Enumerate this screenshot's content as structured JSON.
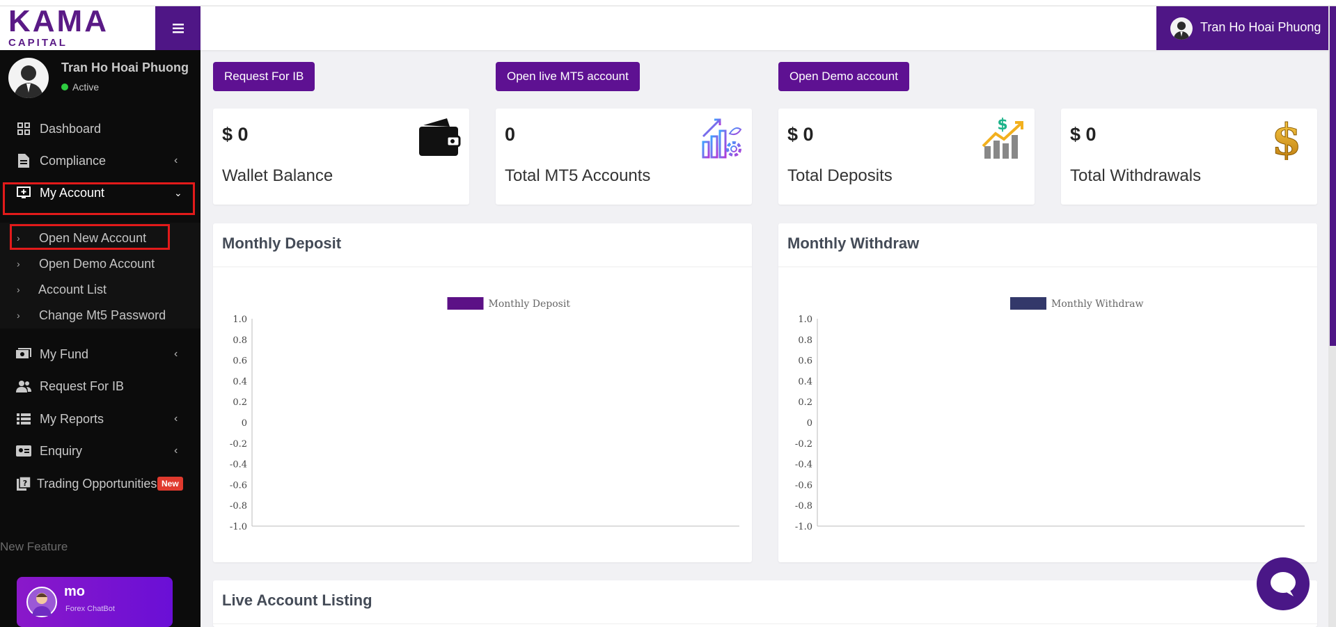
{
  "brand": {
    "logo_text": "KAMA",
    "logo_subtext": "CAPITAL"
  },
  "sidebar": {
    "user": {
      "name": "Tran Ho Hoai Phuong",
      "status": "Active"
    },
    "items": [
      {
        "label": "Dashboard",
        "icon": "grid-icon",
        "has_chevron": false
      },
      {
        "label": "Compliance",
        "icon": "document-icon",
        "has_chevron": true
      },
      {
        "label": "My Account",
        "icon": "monitor-plus-icon",
        "has_chevron": true,
        "expanded": true
      },
      {
        "label": "My Fund",
        "icon": "money-icon",
        "has_chevron": true
      },
      {
        "label": "Request For IB",
        "icon": "users-icon",
        "has_chevron": false
      },
      {
        "label": "My Reports",
        "icon": "list-icon",
        "has_chevron": true
      },
      {
        "label": "Enquiry",
        "icon": "id-card-icon",
        "has_chevron": true
      },
      {
        "label": "Trading Opportunities",
        "icon": "clipboard-question-icon",
        "has_chevron": false,
        "badge": "New"
      }
    ],
    "submenu": [
      {
        "label": "Open New Account"
      },
      {
        "label": "Open Demo Account"
      },
      {
        "label": "Account List"
      },
      {
        "label": "Change Mt5 Password"
      }
    ],
    "new_feature_label": "New Feature",
    "chatbot": {
      "title": "mo",
      "subtitle": "Forex ChatBot"
    }
  },
  "header": {
    "user_name": "Tran Ho Hoai Phuong"
  },
  "actions": {
    "request_ib": "Request For IB",
    "open_live": "Open live MT5 account",
    "open_demo": "Open Demo account"
  },
  "stats": [
    {
      "value": "$ 0",
      "label": "Wallet Balance",
      "icon": "wallet-icon"
    },
    {
      "value": "0",
      "label": "Total MT5 Accounts",
      "icon": "growth-chart-gear-icon"
    },
    {
      "value": "$ 0",
      "label": "Total Deposits",
      "icon": "dollar-bar-chart-icon"
    },
    {
      "value": "$ 0",
      "label": "Total Withdrawals",
      "icon": "gold-dollar-icon"
    }
  ],
  "panels": {
    "deposit_title": "Monthly Deposit",
    "withdraw_title": "Monthly Withdraw",
    "live_listing_title": "Live Account Listing"
  },
  "chart_data": [
    {
      "type": "bar",
      "legend": [
        {
          "name": "Monthly Deposit",
          "color": "#5c1186"
        }
      ],
      "series": [
        {
          "name": "Monthly Deposit",
          "values": []
        }
      ],
      "y_ticks": [
        "1.0",
        "0.8",
        "0.6",
        "0.4",
        "0.2",
        "0",
        "-0.2",
        "-0.4",
        "-0.6",
        "-0.8",
        "-1.0"
      ],
      "ylim": [
        -1.0,
        1.0
      ],
      "legend_position": "top"
    },
    {
      "type": "bar",
      "legend": [
        {
          "name": "Monthly Withdraw",
          "color": "#33386a"
        }
      ],
      "series": [
        {
          "name": "Monthly Withdraw",
          "values": []
        }
      ],
      "y_ticks": [
        "1.0",
        "0.8",
        "0.6",
        "0.4",
        "0.2",
        "0",
        "-0.2",
        "-0.4",
        "-0.6",
        "-0.8",
        "-1.0"
      ],
      "ylim": [
        -1.0,
        1.0
      ],
      "legend_position": "top"
    }
  ],
  "colors": {
    "brand_purple": "#4f1686",
    "button_purple": "#5e1192",
    "sidebar_bg": "#0c0c0c",
    "highlight_red": "#e21a1a",
    "badge_red": "#e03a2e"
  }
}
